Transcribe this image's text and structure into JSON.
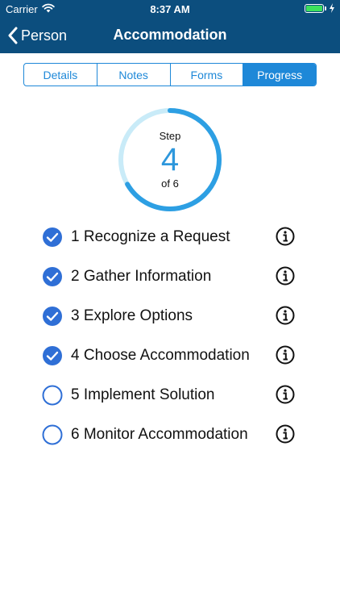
{
  "status_bar": {
    "carrier": "Carrier",
    "time": "8:37 AM"
  },
  "nav": {
    "back_label": "Person",
    "title": "Accommodation"
  },
  "tabs": [
    {
      "label": "Details",
      "active": false
    },
    {
      "label": "Notes",
      "active": false
    },
    {
      "label": "Forms",
      "active": false
    },
    {
      "label": "Progress",
      "active": true
    }
  ],
  "progress": {
    "step_label": "Step",
    "current": "4",
    "of_label": "of 6",
    "completed_fraction": 0.6667
  },
  "steps": [
    {
      "label": "1 Recognize a Request",
      "checked": true
    },
    {
      "label": "2 Gather Information",
      "checked": true
    },
    {
      "label": "3 Explore Options",
      "checked": true
    },
    {
      "label": "4 Choose Accommodation",
      "checked": true
    },
    {
      "label": "5 Implement Solution",
      "checked": false
    },
    {
      "label": "6 Monitor Accommodation",
      "checked": false
    }
  ],
  "colors": {
    "header": "#0c4e7e",
    "accent": "#1e88d8",
    "ring_track": "#c9ebf8",
    "ring_fill": "#2d9fe3",
    "check_fill": "#2f6fd6"
  },
  "icons": {
    "back": "chevron-left-icon",
    "info": "info-circle-icon",
    "check": "checkmark-circle-icon",
    "empty": "empty-circle-icon"
  }
}
